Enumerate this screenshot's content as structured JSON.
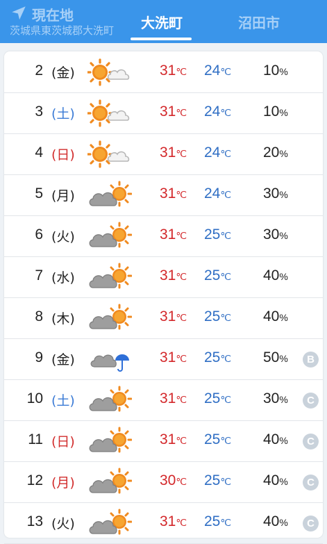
{
  "header": {
    "current_location": {
      "title": "現在地",
      "subtitle": "茨城県東茨城郡大洗町",
      "icon": "location-arrow-icon"
    },
    "tabs": [
      {
        "label": "大洗町",
        "active": true
      },
      {
        "label": "沼田市",
        "active": false
      }
    ]
  },
  "forecast": {
    "rows": [
      {
        "day": "2",
        "dow": "(金)",
        "icon": "sunny-then-cloudy",
        "high": "31",
        "low": "24",
        "pop": "10",
        "badge": ""
      },
      {
        "day": "3",
        "dow": "(土)",
        "icon": "sunny-then-cloudy",
        "high": "31",
        "low": "24",
        "pop": "10",
        "badge": ""
      },
      {
        "day": "4",
        "dow": "(日)",
        "icon": "sunny-then-cloudy",
        "high": "31",
        "low": "24",
        "pop": "20",
        "badge": ""
      },
      {
        "day": "5",
        "dow": "(月)",
        "icon": "cloudy-then-sunny",
        "high": "31",
        "low": "24",
        "pop": "30",
        "badge": ""
      },
      {
        "day": "6",
        "dow": "(火)",
        "icon": "cloudy-then-sunny",
        "high": "31",
        "low": "25",
        "pop": "30",
        "badge": ""
      },
      {
        "day": "7",
        "dow": "(水)",
        "icon": "cloudy-then-sunny",
        "high": "31",
        "low": "25",
        "pop": "40",
        "badge": ""
      },
      {
        "day": "8",
        "dow": "(木)",
        "icon": "cloudy-then-sunny",
        "high": "31",
        "low": "25",
        "pop": "40",
        "badge": ""
      },
      {
        "day": "9",
        "dow": "(金)",
        "icon": "cloudy-then-rain",
        "high": "31",
        "low": "25",
        "pop": "50",
        "badge": "B"
      },
      {
        "day": "10",
        "dow": "(土)",
        "icon": "cloudy-then-sunny",
        "high": "31",
        "low": "25",
        "pop": "30",
        "badge": "C"
      },
      {
        "day": "11",
        "dow": "(日)",
        "icon": "cloudy-then-sunny",
        "high": "31",
        "low": "25",
        "pop": "40",
        "badge": "C"
      },
      {
        "day": "12",
        "dow": "(月)",
        "icon": "cloudy-then-sunny",
        "high": "30",
        "low": "25",
        "pop": "40",
        "badge": "C"
      },
      {
        "day": "13",
        "dow": "(火)",
        "icon": "cloudy-then-sunny",
        "high": "31",
        "low": "25",
        "pop": "40",
        "badge": "C"
      }
    ],
    "temp_unit": "℃",
    "pop_unit": "%"
  },
  "colors": {
    "header": "#3a95ea",
    "high": "#d3272a",
    "low": "#2f6ec4",
    "saturday": "#3b7bd6",
    "sunday": "#d22d2d",
    "badge": "#c9d2db"
  }
}
